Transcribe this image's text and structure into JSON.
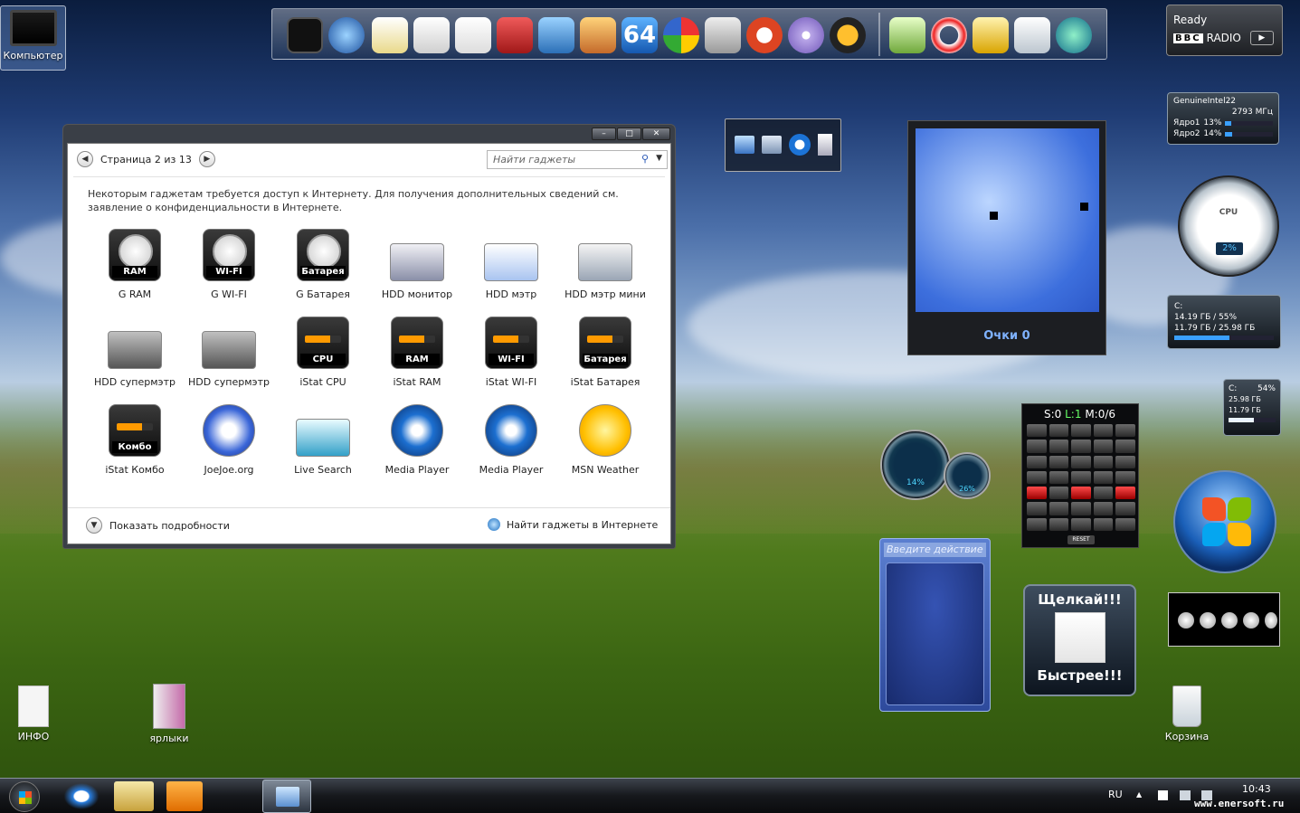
{
  "desktop": {
    "icons": [
      {
        "label": "Компьютер"
      },
      {
        "label": "ИНФО"
      },
      {
        "label": "ярлыки"
      },
      {
        "label": "Корзина"
      }
    ]
  },
  "radio": {
    "status": "Ready",
    "brand": "BBC",
    "name": "RADIO"
  },
  "cpu_meter": {
    "processor": "GenuineIntel22",
    "freq": "2793 МГц",
    "core1_label": "Ядро1",
    "core1": "13%",
    "core2_label": "Ядро2",
    "core2": "14%",
    "core1_value": 0.13,
    "core2_value": 0.14
  },
  "cpu_gauge": {
    "label": "CPU",
    "value": "2%"
  },
  "drive1": {
    "name": "C:",
    "line1": "14.19 ГБ / 55%",
    "line2": "11.79 ГБ / 25.98 ГБ",
    "fill": 0.55
  },
  "drive2": {
    "name": "C:",
    "percent": "54%",
    "line1": "25.98 ГБ",
    "line2": "11.79 ГБ",
    "fill": 0.54
  },
  "game": {
    "score": "Очки 0"
  },
  "sequencer": {
    "status_s": "S:0",
    "status_l": "L:1",
    "status_m": "M:0/6",
    "reset": "RESET"
  },
  "speed": {
    "v1": "14%",
    "v2": "26%"
  },
  "action": {
    "placeholder": "Введите действие"
  },
  "clicker": {
    "top": "Щелкай!!!",
    "bottom": "Быстрее!!!"
  },
  "gallery": {
    "page": "Страница 2 из 13",
    "search_placeholder": "Найти гаджеты",
    "info": "Некоторым гаджетам требуется доступ к Интернету. Для получения дополнительных сведений см. заявление о конфиденциальности в Интернете.",
    "items": [
      {
        "name": "G RAM",
        "badge": "RAM"
      },
      {
        "name": "G WI-FI",
        "badge": "WI-FI"
      },
      {
        "name": "G Батарея",
        "badge": "Батарея"
      },
      {
        "name": "HDD монитор",
        "badge": ""
      },
      {
        "name": "HDD мэтр",
        "badge": ""
      },
      {
        "name": "HDD мэтр мини",
        "badge": ""
      },
      {
        "name": "HDD супермэтр",
        "badge": ""
      },
      {
        "name": "HDD супермэтр",
        "badge": ""
      },
      {
        "name": "iStat CPU",
        "badge": "CPU"
      },
      {
        "name": "iStat RAM",
        "badge": "RAM"
      },
      {
        "name": "iStat WI-FI",
        "badge": "WI-FI"
      },
      {
        "name": "iStat Батарея",
        "badge": "Батарея"
      },
      {
        "name": "iStat Комбо",
        "badge": "Комбо"
      },
      {
        "name": "JoeJoe.org",
        "badge": ""
      },
      {
        "name": "Live Search",
        "badge": ""
      },
      {
        "name": "Media Player",
        "badge": ""
      },
      {
        "name": "Media Player",
        "badge": ""
      },
      {
        "name": "MSN Weather",
        "badge": ""
      }
    ],
    "details": "Показать подробности",
    "online": "Найти гаджеты в Интернете"
  },
  "taskbar": {
    "lang": "RU",
    "time": "10:43",
    "watermark": "www.enersoft.ru"
  },
  "colors": {
    "accent": "#2a59b6",
    "orange": "#ff9a00"
  }
}
